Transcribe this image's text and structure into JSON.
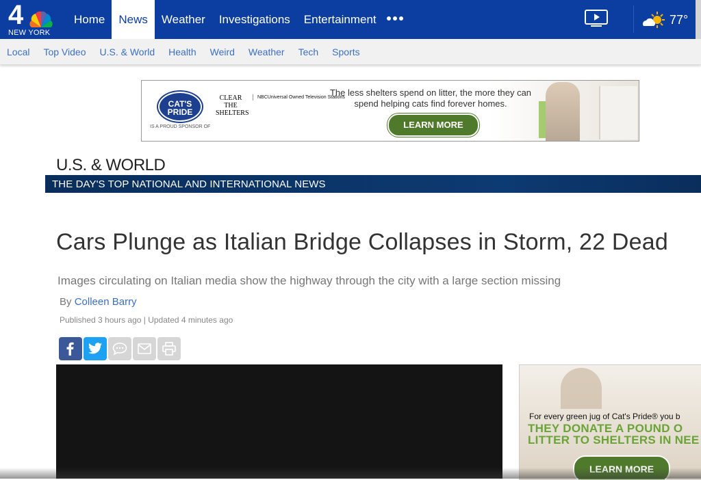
{
  "header": {
    "logo_number": "4",
    "logo_city": "NEW YORK",
    "nav": [
      {
        "label": "Home",
        "active": false
      },
      {
        "label": "News",
        "active": true
      },
      {
        "label": "Weather",
        "active": false
      },
      {
        "label": "Investigations",
        "active": false
      },
      {
        "label": "Entertainment",
        "active": false
      }
    ],
    "more_icon": "ellipsis-icon",
    "video_icon": "video-play-icon",
    "weather_icon": "partly-sunny-icon",
    "temperature": "77°"
  },
  "subnav": {
    "items": [
      "Local",
      "Top Video",
      "U.S. & World",
      "Health",
      "Weird",
      "Weather",
      "Tech",
      "Sports"
    ]
  },
  "banner_ad": {
    "brand": "CAT'S PRIDE",
    "sponsor_text": "IS A PROUD SPONSOR OF",
    "partner": "CLEAR THE SHELTERS",
    "network": "NBCUniversal Owned Television Stations",
    "message": "The less shelters spend on litter, the more they can spend helping cats find forever homes.",
    "cta": "LEARN MORE"
  },
  "section": {
    "title": "U.S. & WORLD",
    "tagline": "THE DAY'S TOP NATIONAL AND INTERNATIONAL NEWS"
  },
  "article": {
    "headline": "Cars Plunge as Italian Bridge Collapses in Storm, 22 Dead",
    "dek": "Images circulating on Italian media show the highway through the city with a large section missing",
    "by_prefix": "By",
    "author": "Colleen Barry",
    "published": "Published 3 hours ago | Updated 4 minutes ago"
  },
  "share": [
    "facebook-icon",
    "twitter-icon",
    "comment-icon",
    "email-icon",
    "print-icon"
  ],
  "side_ad": {
    "line1": "For every green jug of Cat's Pride® you b",
    "line2a": "THEY DONATE A POUND O",
    "line2b": "LITTER TO SHELTERS IN NEE",
    "cta": "LEARN MORE"
  },
  "colors": {
    "brand_blue": "#0b3ea0",
    "link_blue": "#3b6fc4",
    "section_navy": "#0a2e5c",
    "cta_green": "#4f7a2c"
  }
}
